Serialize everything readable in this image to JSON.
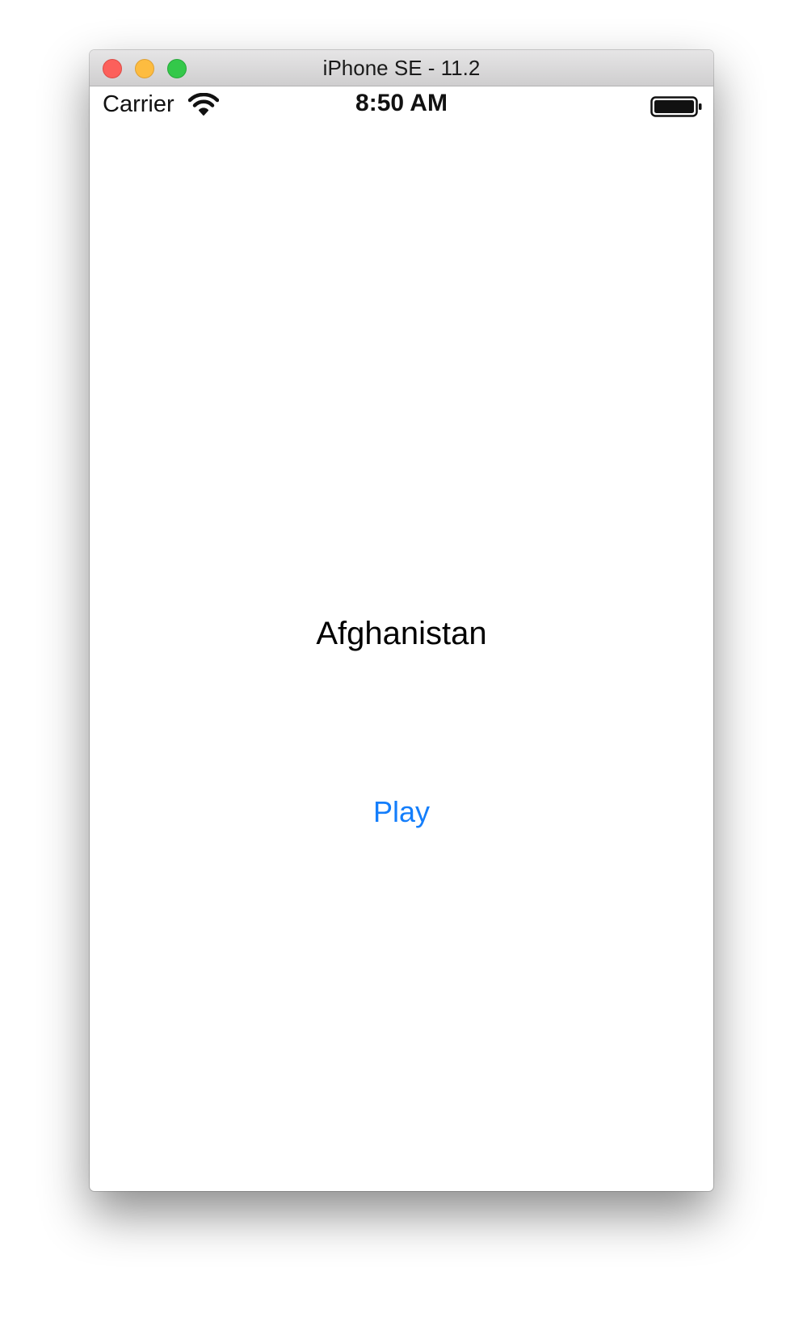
{
  "window": {
    "title": "iPhone SE - 11.2"
  },
  "status_bar": {
    "carrier": "Carrier",
    "time": "8:50 AM",
    "wifi_icon": "wifi-icon",
    "battery_icon": "battery-icon"
  },
  "content": {
    "country": "Afghanistan",
    "play_label": "Play"
  },
  "colors": {
    "accent": "#147efb",
    "close": "#fc605b",
    "minimize": "#fdbc40",
    "zoom": "#34c84a"
  }
}
